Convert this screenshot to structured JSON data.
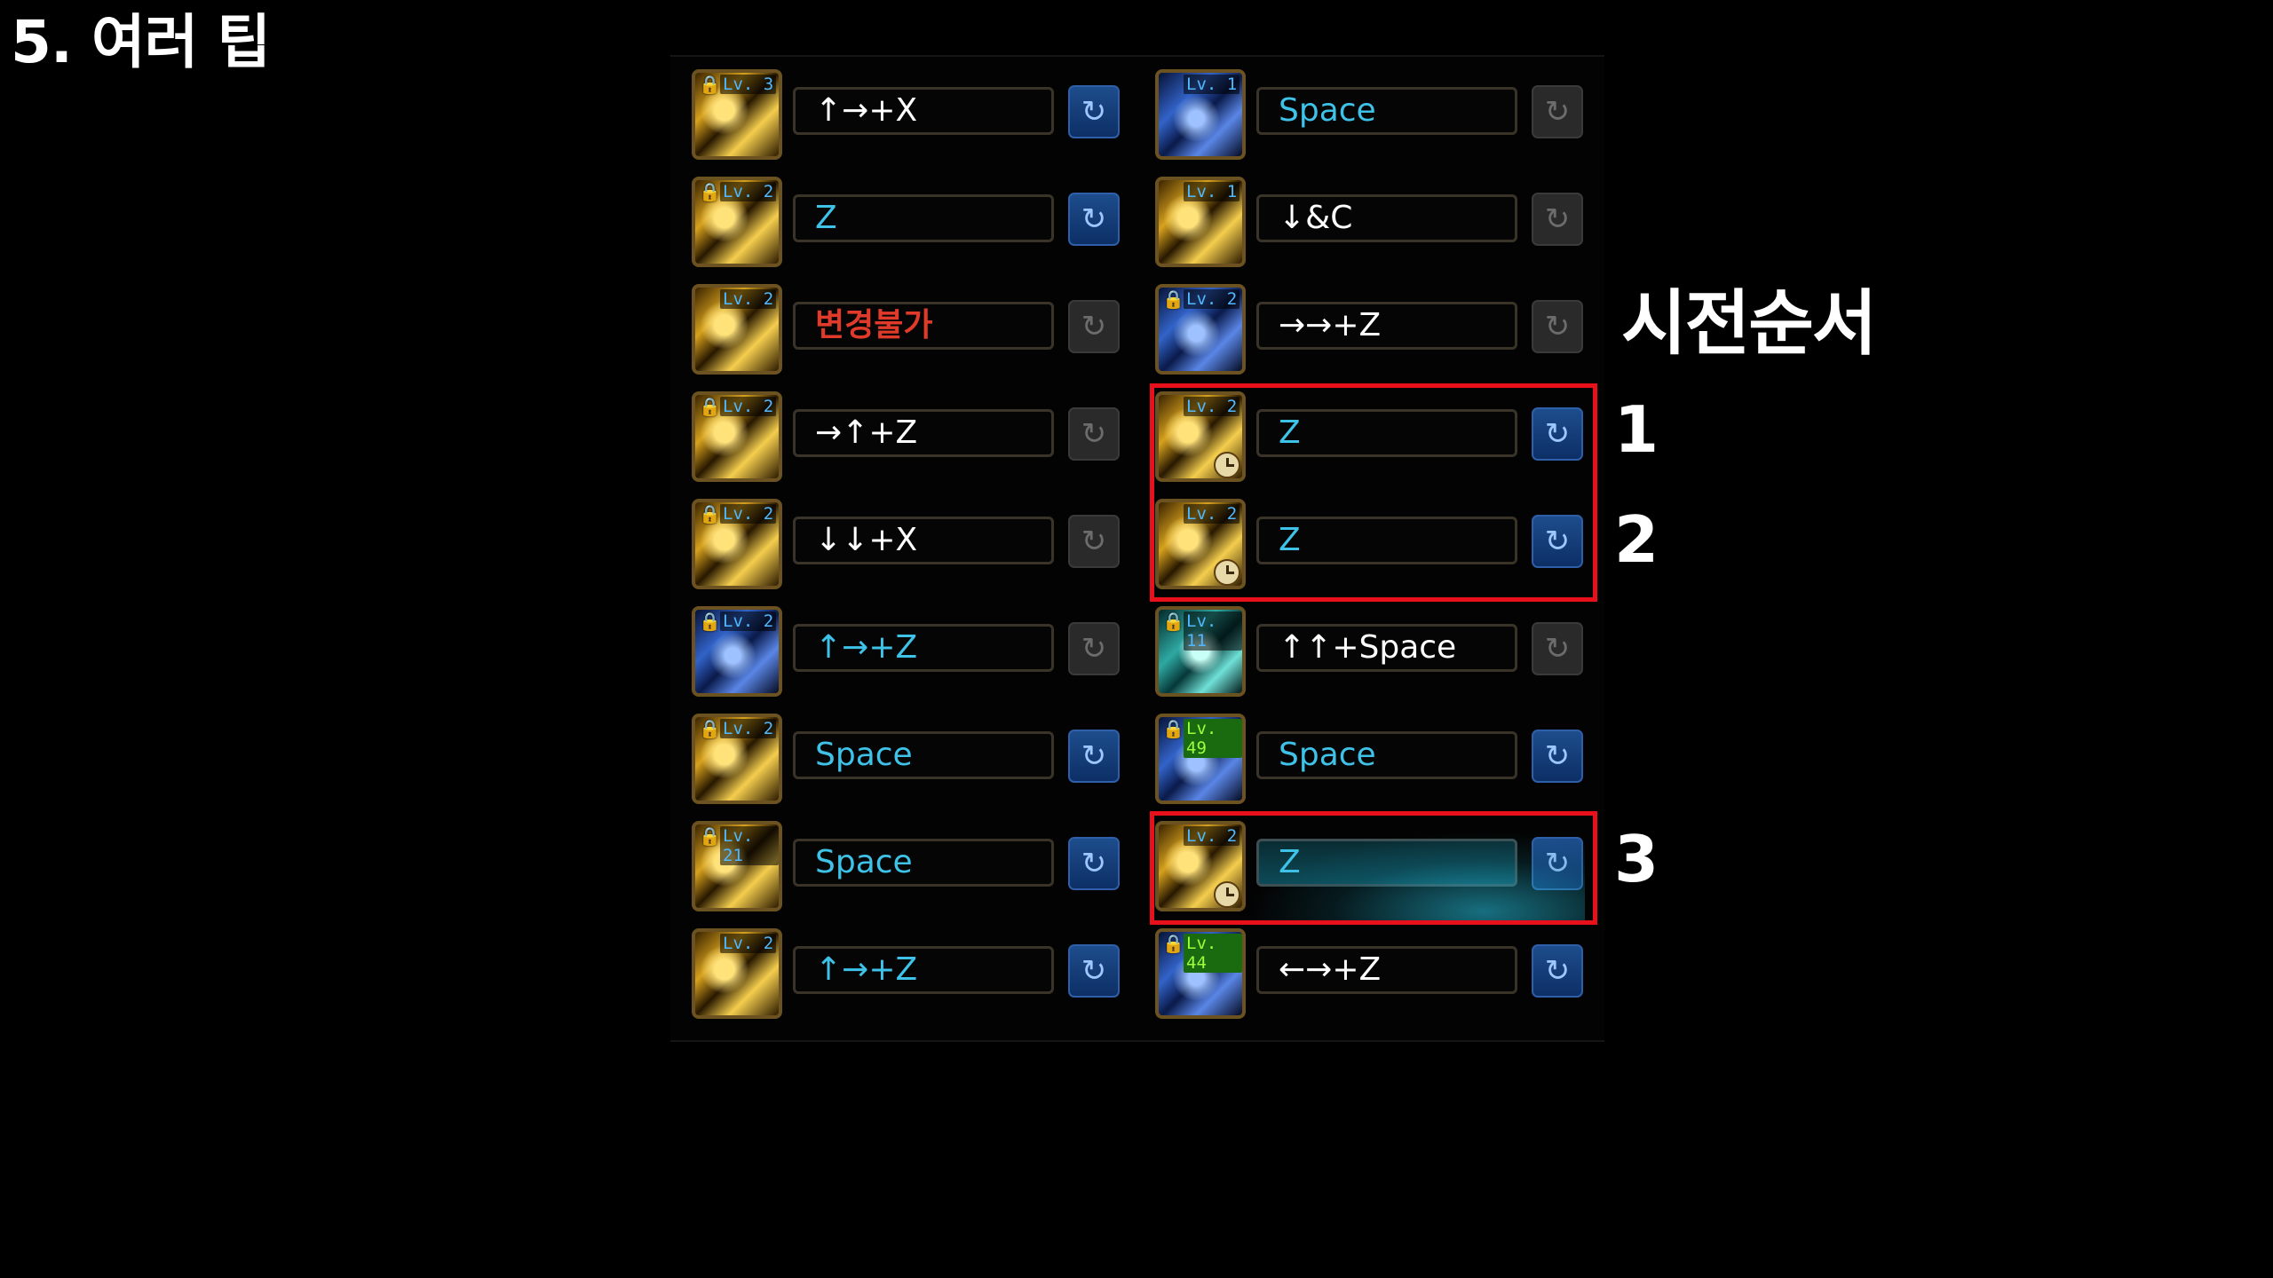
{
  "page_title": "5. 여러 팁",
  "order_title": "시전순서",
  "order_numbers": [
    "1",
    "2",
    "3"
  ],
  "left_skills": [
    {
      "level": "Lv. 3",
      "key": "↑→+X",
      "key_color": "white",
      "icon_theme": "gold",
      "locked": true,
      "refresh_active": true
    },
    {
      "level": "Lv. 2",
      "key": "Z",
      "key_color": "cyan",
      "icon_theme": "gold",
      "locked": true,
      "refresh_active": true
    },
    {
      "level": "Lv. 2",
      "key": "변경불가",
      "key_color": "red",
      "icon_theme": "gold",
      "locked": false,
      "refresh_active": false
    },
    {
      "level": "Lv. 2",
      "key": "→↑+Z",
      "key_color": "white",
      "icon_theme": "gold",
      "locked": true,
      "refresh_active": false
    },
    {
      "level": "Lv. 2",
      "key": "↓↓+X",
      "key_color": "white",
      "icon_theme": "gold",
      "locked": true,
      "refresh_active": false
    },
    {
      "level": "Lv. 2",
      "key": "↑→+Z",
      "key_color": "cyan",
      "icon_theme": "blue",
      "locked": true,
      "refresh_active": false
    },
    {
      "level": "Lv. 2",
      "key": "Space",
      "key_color": "cyan",
      "icon_theme": "gold",
      "locked": true,
      "refresh_active": true
    },
    {
      "level": "Lv. 21",
      "key": "Space",
      "key_color": "cyan",
      "icon_theme": "gold",
      "locked": true,
      "refresh_active": true
    },
    {
      "level": "Lv. 2",
      "key": "↑→+Z",
      "key_color": "cyan",
      "icon_theme": "gold",
      "locked": false,
      "refresh_active": true
    }
  ],
  "right_skills": [
    {
      "level": "Lv. 1",
      "key": "Space",
      "key_color": "cyan",
      "icon_theme": "blue",
      "locked": false,
      "refresh_active": false
    },
    {
      "level": "Lv. 1",
      "key": "↓&C",
      "key_color": "white",
      "icon_theme": "gold",
      "locked": false,
      "refresh_active": false
    },
    {
      "level": "Lv. 2",
      "key": "→→+Z",
      "key_color": "white",
      "icon_theme": "blue",
      "locked": true,
      "refresh_active": false
    },
    {
      "level": "Lv. 2",
      "key": "Z",
      "key_color": "cyan",
      "icon_theme": "gold",
      "locked": false,
      "refresh_active": true,
      "cooldown": true
    },
    {
      "level": "Lv. 2",
      "key": "Z",
      "key_color": "cyan",
      "icon_theme": "gold",
      "locked": false,
      "refresh_active": true,
      "cooldown": true
    },
    {
      "level": "Lv. 11",
      "key": "↑↑+Space",
      "key_color": "white",
      "icon_theme": "teal",
      "locked": true,
      "refresh_active": false
    },
    {
      "level": "Lv. 49",
      "key": "Space",
      "key_color": "cyan",
      "icon_theme": "blue",
      "locked": true,
      "refresh_active": true,
      "level_green": true
    },
    {
      "level": "Lv. 2",
      "key": "Z",
      "key_color": "cyan",
      "icon_theme": "gold",
      "locked": false,
      "refresh_active": true,
      "cooldown": true,
      "glow": true
    },
    {
      "level": "Lv. 44",
      "key": "←→+Z",
      "key_color": "white",
      "icon_theme": "blue",
      "locked": true,
      "refresh_active": true,
      "level_green": true
    }
  ],
  "icons": {
    "lock": "lock-icon",
    "refresh": "refresh-icon",
    "cooldown": "clock-icon"
  },
  "colors": {
    "highlight": "#e8101a",
    "key_cyan": "#3ec2e8",
    "key_red": "#e03b2a",
    "refresh_active": "#1d4d8c"
  }
}
